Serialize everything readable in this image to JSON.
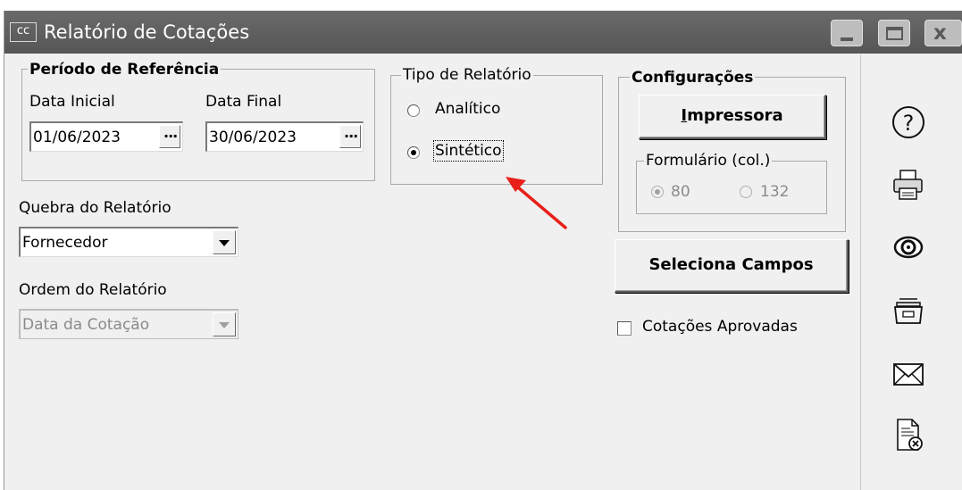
{
  "window": {
    "app_icon_text": "cc",
    "title": "Relatório de Cotações",
    "controls": [
      "minimize-icon",
      "maximize-icon",
      "close-icon"
    ],
    "close_glyph": "x"
  },
  "periodo": {
    "legend": "Período de Referência",
    "data_inicial_label": "Data Inicial",
    "data_inicial_value": "01/06/2023",
    "data_final_label": "Data Final",
    "data_final_value": "30/06/2023",
    "ellipsis": "..."
  },
  "tipo": {
    "legend": "Tipo de Relatório",
    "options": [
      "Analítico",
      "Sintético"
    ],
    "selected": "Sintético"
  },
  "configuracoes": {
    "legend": "Configurações",
    "printer_button_prefix": "I",
    "printer_button_rest": "mpressora",
    "formulario_legend": "Formulário (col.)",
    "formulario_options": [
      "80",
      "132"
    ],
    "formulario_selected": "80"
  },
  "quebra": {
    "label": "Quebra do Relatório",
    "value": "Fornecedor"
  },
  "ordem": {
    "label": "Ordem do Relatório",
    "value": "Data da Cotação"
  },
  "seleciona_campos": "Seleciona Campos",
  "cotacoes_aprovadas": {
    "label": "Cotações Aprovadas",
    "checked": false
  },
  "toolbar": {
    "icons": [
      "help-icon",
      "printer-icon",
      "preview-eye-icon",
      "archive-icon",
      "envelope-icon",
      "close-document-icon"
    ],
    "help_glyph": "?"
  },
  "annotation_color": "#e8201a"
}
